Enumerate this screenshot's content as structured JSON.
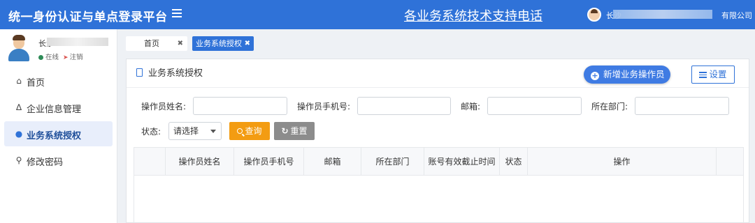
{
  "header": {
    "app_title": "统一身份认证与单点登录平台",
    "support_link": "各业务系统技术支持电话",
    "user_company_prefix": "长沙",
    "user_company_suffix": "有限公司"
  },
  "sidebar": {
    "profile": {
      "name_prefix": "长沙",
      "status": "在线",
      "logout": "注销"
    },
    "items": [
      {
        "label": "首页",
        "icon": "home-icon"
      },
      {
        "label": "企业信息管理",
        "icon": "bank-icon"
      },
      {
        "label": "业务系统授权",
        "icon": "users-icon",
        "active": true
      },
      {
        "label": "修改密码",
        "icon": "key-icon"
      }
    ]
  },
  "tabs": [
    {
      "label": "首页"
    },
    {
      "label": "业务系统授权",
      "active": true
    }
  ],
  "panel": {
    "title": "业务系统授权",
    "add_button": "新增业务操作员",
    "settings_button": "设置"
  },
  "filters": {
    "operator_name_label": "操作员姓名:",
    "operator_phone_label": "操作员手机号:",
    "email_label": "邮箱:",
    "department_label": "所在部门:",
    "status_label": "状态:",
    "status_value": "请选择",
    "query_button": "查询",
    "reset_button": "重置"
  },
  "table": {
    "columns": [
      "操作员姓名",
      "操作员手机号",
      "邮箱",
      "所在部门",
      "账号有效截止时间",
      "状态",
      "操作"
    ],
    "rows": []
  },
  "colors": {
    "primary": "#2f72d8",
    "query": "#f39c12",
    "reset": "#8c8c8c"
  }
}
